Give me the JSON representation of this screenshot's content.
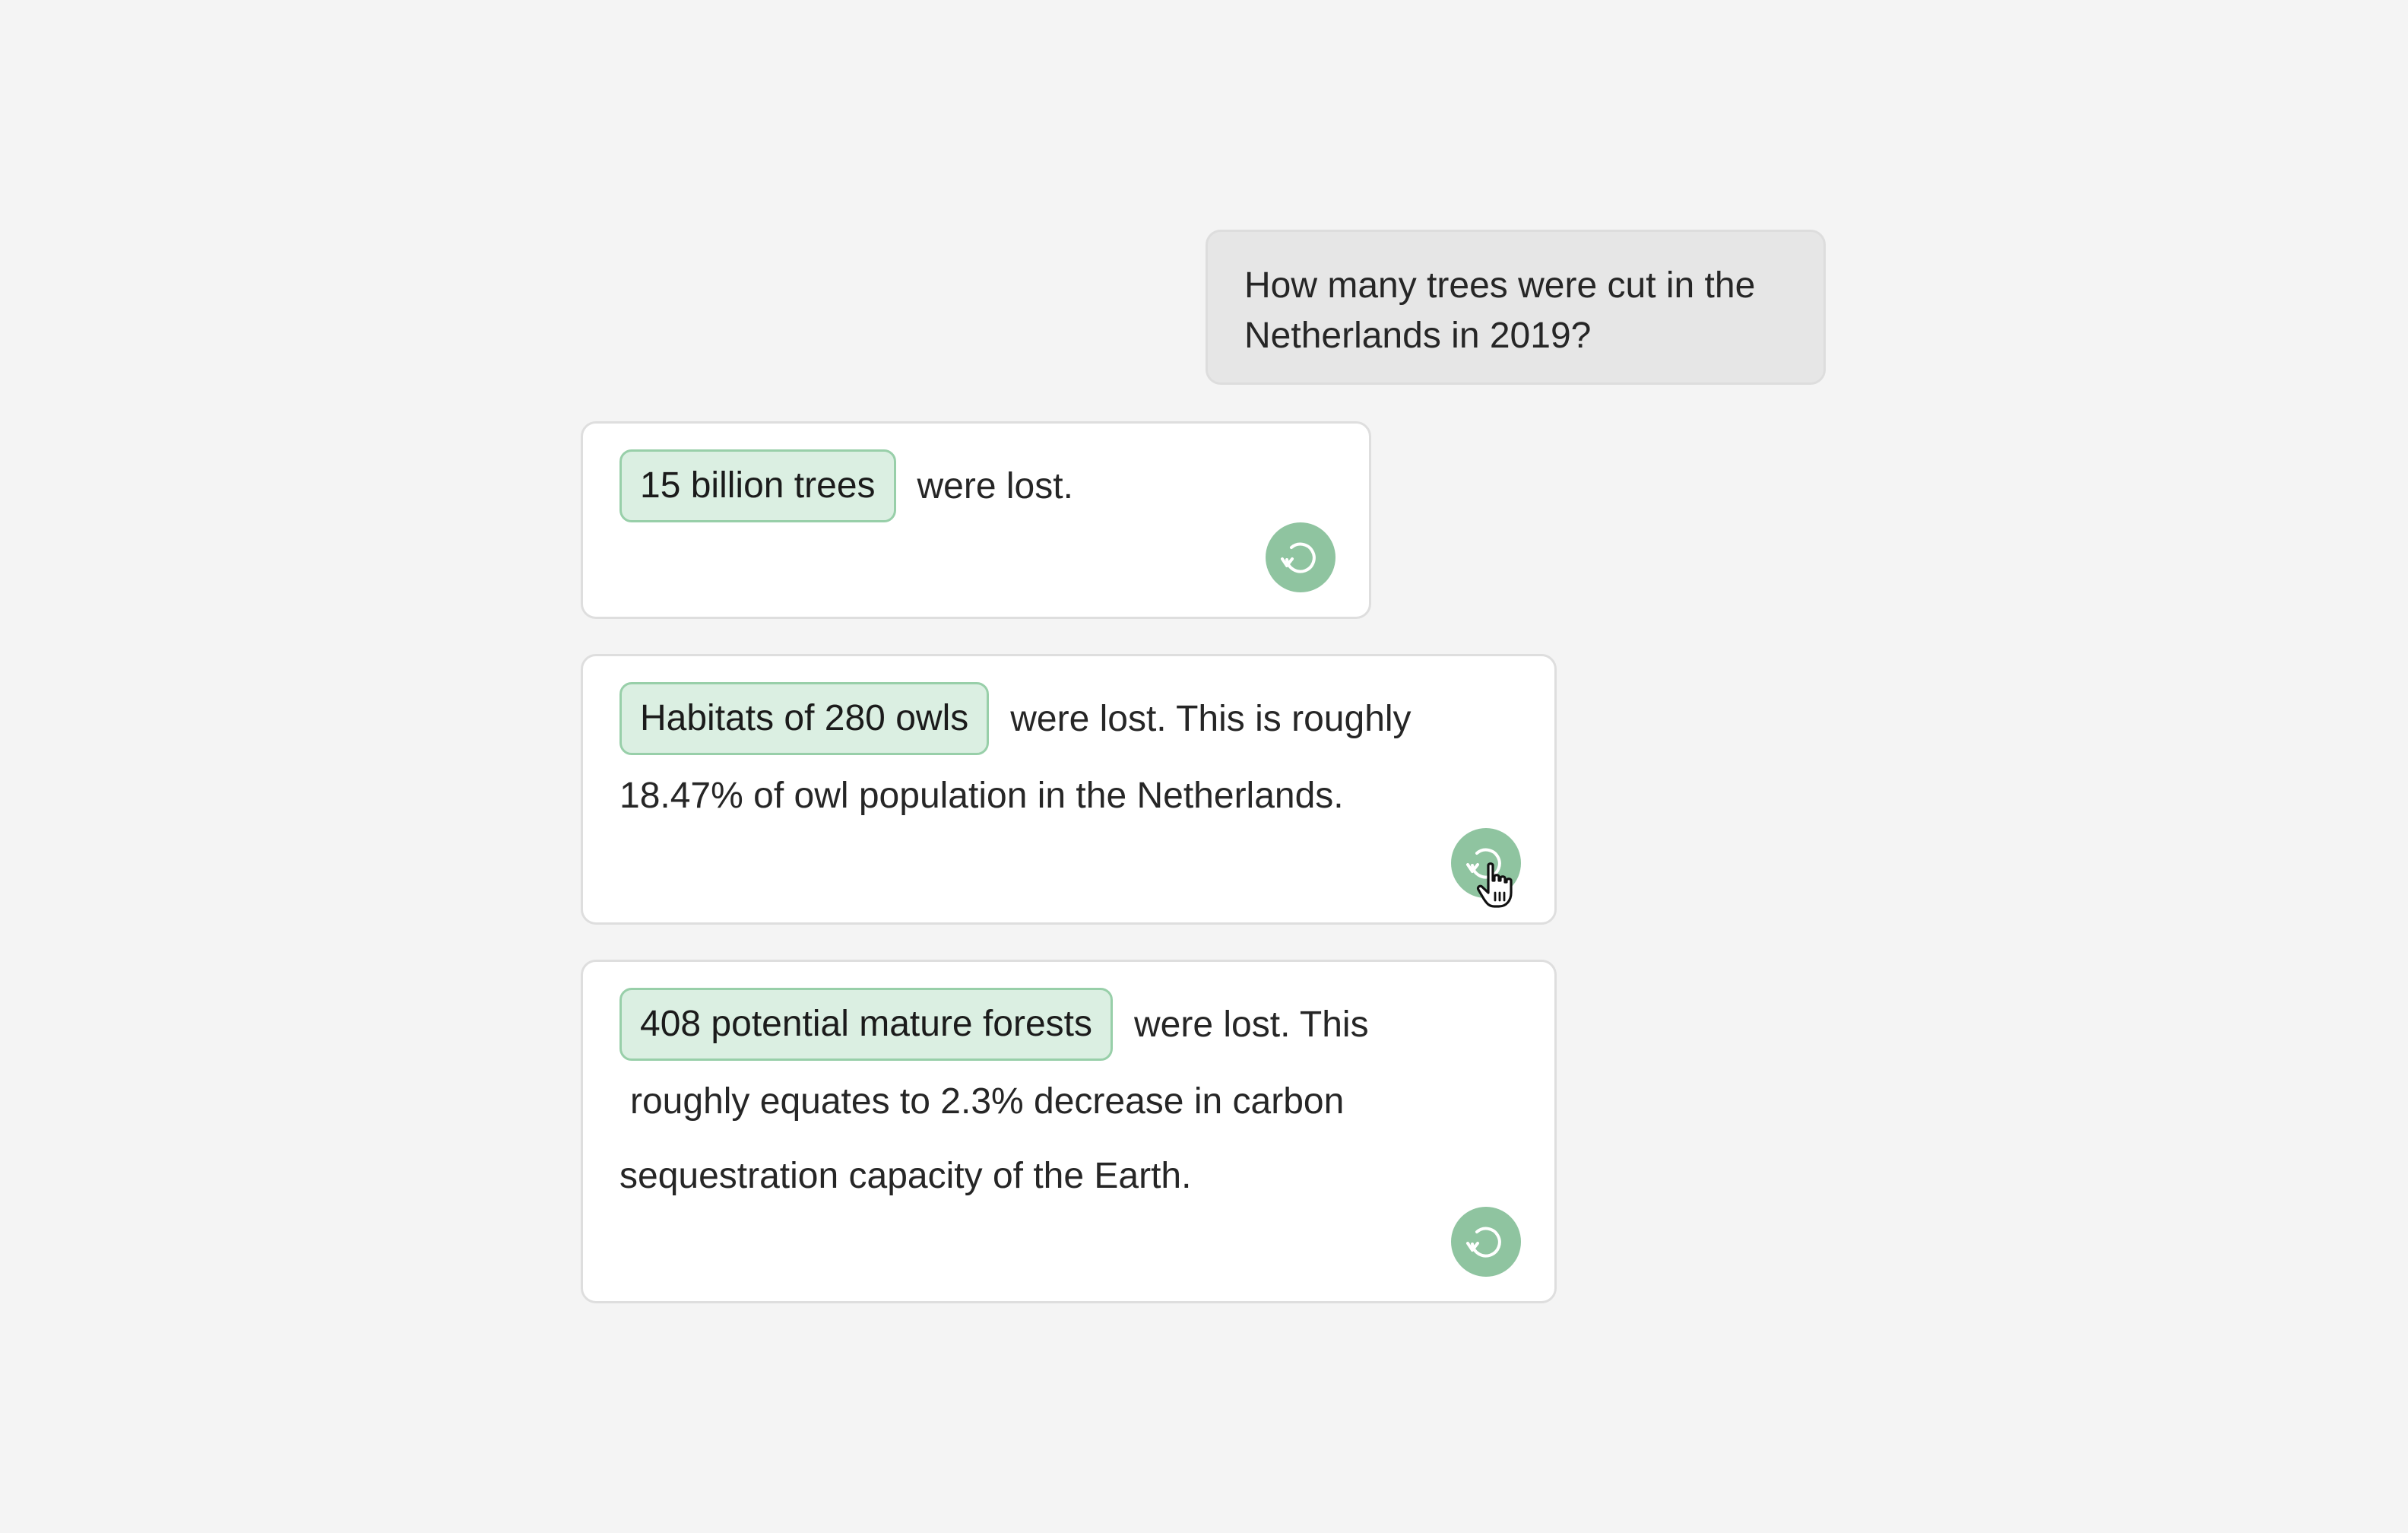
{
  "user_message": {
    "line1": "How many trees were cut in the",
    "line2": "Netherlands in 2019?"
  },
  "responses": [
    {
      "highlight": "15 billion trees",
      "line1_rest": "were lost.",
      "icon": "refresh-icon"
    },
    {
      "highlight": "Habitats of 280 owls",
      "line1_rest": "were lost. This is roughly",
      "line2": "18.47% of owl population in the Netherlands.",
      "icon": "refresh-icon"
    },
    {
      "highlight": "408 potential mature forests",
      "line1_rest": "were lost. This",
      "line2": "roughly equates to 2.3% decrease in carbon",
      "line3": "sequestration capacity of the Earth.",
      "icon": "refresh-icon"
    }
  ],
  "colors": {
    "background": "#f4f4f4",
    "user_bubble": "#e6e6e6",
    "chip_fill": "#dbefe2",
    "chip_border": "#98cfa9",
    "button": "#8fc4a0"
  }
}
